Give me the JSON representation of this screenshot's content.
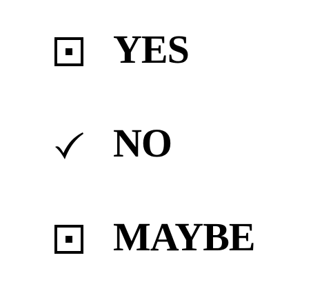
{
  "colors": {
    "ink": "#000000",
    "background": "#ffffff"
  },
  "options": [
    {
      "label": "YES",
      "icon": "boxed-dot-icon",
      "selected": false
    },
    {
      "label": "NO",
      "icon": "checkmark-icon",
      "selected": true
    },
    {
      "label": "MAYBE",
      "icon": "boxed-dot-icon",
      "selected": false
    }
  ]
}
